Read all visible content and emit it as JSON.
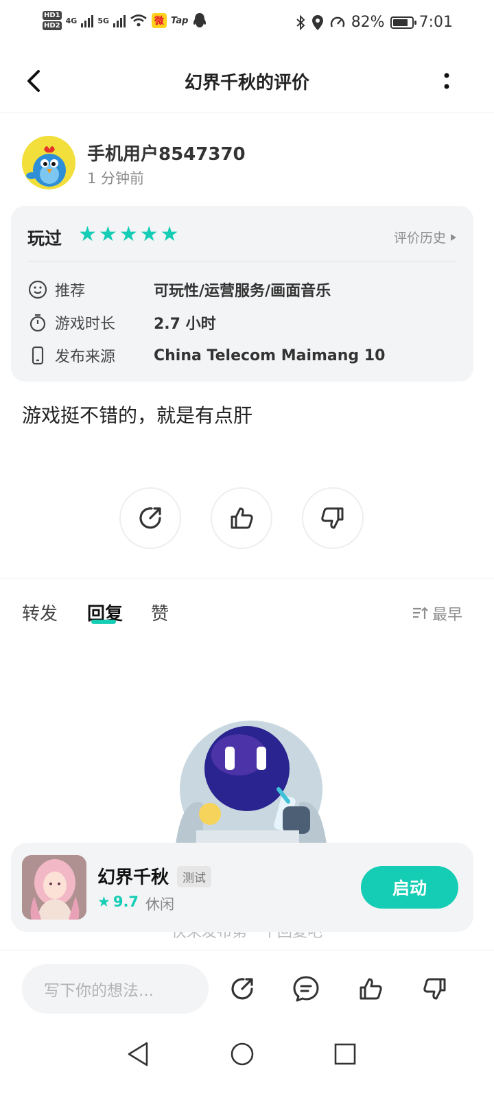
{
  "status_bar": {
    "carrier_tags": [
      "HD1",
      "HD2"
    ],
    "net1": "4G",
    "net2": "5G",
    "app_tap": "Tap",
    "battery_percent": "82%",
    "battery_level": 0.82,
    "time": "7:01"
  },
  "header": {
    "title": "幻界千秋的评价"
  },
  "review": {
    "username": "手机用户8547370",
    "time_ago": "1 分钟前",
    "played_label": "玩过",
    "rating_stars": 5,
    "star_glyph": "★",
    "history_label": "评价历史",
    "details": [
      {
        "label": "推荐",
        "value": "可玩性/运营服务/画面音乐",
        "icon": "smiley-icon"
      },
      {
        "label": "游戏时长",
        "value": "2.7 小时",
        "icon": "stopwatch-icon"
      },
      {
        "label": "发布来源",
        "value": "China Telecom Maimang 10",
        "icon": "phone-icon"
      }
    ],
    "comment": "游戏挺不错的，就是有点肝"
  },
  "tabs": {
    "items": [
      "转发",
      "回复",
      "赞"
    ],
    "active": "回复",
    "sort_label": "最早"
  },
  "empty_state": {
    "text": "快来发布第一个回复吧"
  },
  "game_card": {
    "name": "幻界千秋",
    "badge": "测试",
    "rating": "9.7",
    "category": "休闲",
    "launch_label": "启动"
  },
  "bottom_bar": {
    "placeholder": "写下你的想法..."
  },
  "colors": {
    "accent": "#14cdb4",
    "card_bg": "#f3f4f6"
  }
}
